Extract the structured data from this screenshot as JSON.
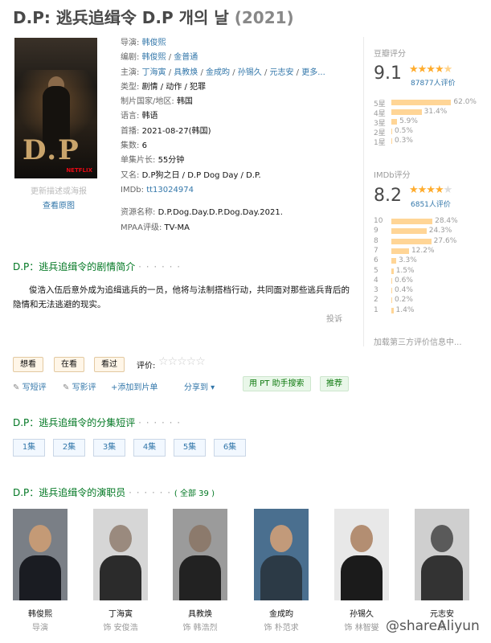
{
  "title": {
    "main": "D.P: 逃兵追缉令 D.P 개의 날",
    "year": "(2021)"
  },
  "poster": {
    "caption": "更新描述或海报",
    "view_link": "查看原图",
    "logo_text": "D.P",
    "brand": "NETFLIX"
  },
  "info": {
    "director_label": "导演:",
    "director": "韩俊熙",
    "writer_label": "编剧:",
    "writers": [
      "韩俊熙",
      "金普通"
    ],
    "cast_label": "主演:",
    "cast": [
      "丁海寅",
      "具教焕",
      "金成昀",
      "孙锡久",
      "元志安"
    ],
    "cast_more": "更多...",
    "genre_label": "类型:",
    "genre": "剧情 / 动作 / 犯罪",
    "country_label": "制片国家/地区:",
    "country": "韩国",
    "language_label": "语言:",
    "language": "韩语",
    "premiere_label": "首播:",
    "premiere": "2021-08-27(韩国)",
    "episodes_label": "集数:",
    "episodes": "6",
    "runtime_label": "单集片长:",
    "runtime": "55分钟",
    "aka_label": "又名:",
    "aka": "D.P狗之日 / D.P Dog Day / D.P.",
    "imdb_label": "IMDb:",
    "imdb": "tt13024974",
    "resource_label": "资源名称:",
    "resource": "D.P.Dog.Day.D.P.Dog.Day.2021.",
    "mpaa_label": "MPAA评级:",
    "mpaa": "TV-MA"
  },
  "douban": {
    "title": "豆瓣评分",
    "score": "9.1",
    "stars": 4.5,
    "count": "87877人评价",
    "bars": [
      {
        "label": "5星",
        "pct": "62.0%",
        "value": 62.0
      },
      {
        "label": "4星",
        "pct": "31.4%",
        "value": 31.4
      },
      {
        "label": "3星",
        "pct": "5.9%",
        "value": 5.9
      },
      {
        "label": "2星",
        "pct": "0.5%",
        "value": 0.5
      },
      {
        "label": "1星",
        "pct": "0.3%",
        "value": 0.3
      }
    ]
  },
  "imdb_rating": {
    "title": "IMDb评分",
    "score": "8.2",
    "stars": 4,
    "count": "6851人评价",
    "bars": [
      {
        "label": "10",
        "pct": "28.4%",
        "value": 28.4
      },
      {
        "label": "9",
        "pct": "24.3%",
        "value": 24.3
      },
      {
        "label": "8",
        "pct": "27.6%",
        "value": 27.6
      },
      {
        "label": "7",
        "pct": "12.2%",
        "value": 12.2
      },
      {
        "label": "6",
        "pct": "3.3%",
        "value": 3.3
      },
      {
        "label": "5",
        "pct": "1.5%",
        "value": 1.5
      },
      {
        "label": "4",
        "pct": "0.6%",
        "value": 0.6
      },
      {
        "label": "3",
        "pct": "0.4%",
        "value": 0.4
      },
      {
        "label": "2",
        "pct": "0.2%",
        "value": 0.2
      },
      {
        "label": "1",
        "pct": "1.4%",
        "value": 1.4
      }
    ],
    "third_party": "加载第三方评价信息中..."
  },
  "summary": {
    "title": "D.P：逃兵追缉令的剧情简介",
    "dots": "· · · · · ·",
    "text": "俊浩入伍后意外成为追缉逃兵的一员，他将与法制搭档行动，共同面对那些逃兵背后的隐情和无法逃避的现实。",
    "report": "投诉"
  },
  "actions": {
    "want": "想看",
    "watching": "在看",
    "watched": "看过",
    "rate_label": "评价:",
    "rate_stars": "☆☆☆☆☆",
    "short_review": "写短评",
    "review": "写影评",
    "add_list": "添加到片单",
    "share": "分享到 ▾",
    "pt_search": "用 PT 助手搜索",
    "recommend": "推荐"
  },
  "episodes": {
    "title": "D.P：逃兵追缉令的分集短评",
    "dots": "· · · · · ·",
    "items": [
      "1集",
      "2集",
      "3集",
      "4集",
      "5集",
      "6集"
    ]
  },
  "cast_section": {
    "title": "D.P：逃兵追缉令的演职员",
    "dots": "· · · · · ·",
    "all": "( 全部 39 )",
    "people": [
      {
        "name": "韩俊熙",
        "role": "导演"
      },
      {
        "name": "丁海寅",
        "role": "饰 安俊浩"
      },
      {
        "name": "具教焕",
        "role": "饰 韩浩烈"
      },
      {
        "name": "金成昀",
        "role": "饰 朴范求"
      },
      {
        "name": "孙锡久",
        "role": "饰 林智燮"
      },
      {
        "name": "元志安",
        "role": "饰"
      }
    ]
  },
  "watermark": "@shareAliyun"
}
